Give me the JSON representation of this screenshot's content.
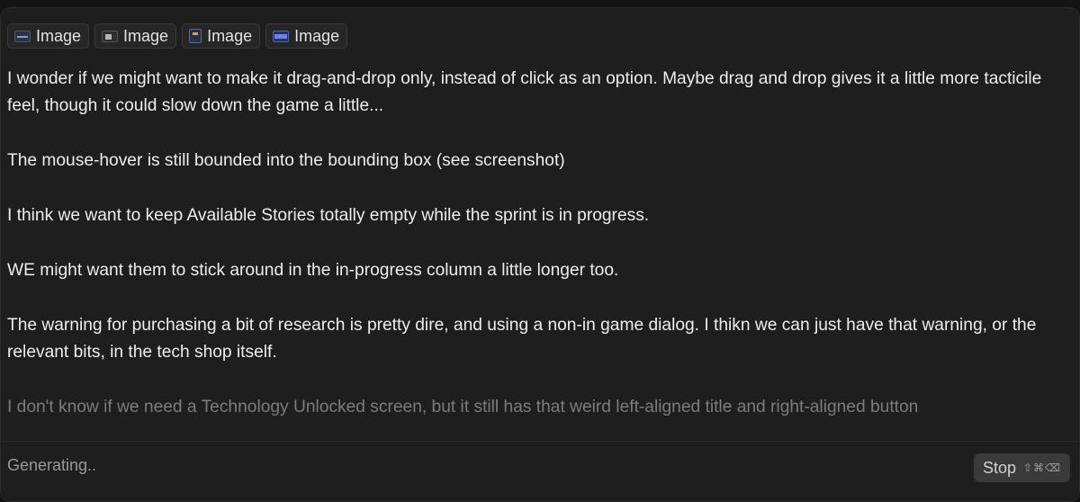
{
  "attachments": [
    {
      "label": "Image",
      "icon": "image-thumbnail-icon"
    },
    {
      "label": "Image",
      "icon": "image-thumbnail-icon"
    },
    {
      "label": "Image",
      "icon": "image-thumbnail-icon"
    },
    {
      "label": "Image",
      "icon": "image-thumbnail-icon"
    }
  ],
  "message": {
    "paragraphs": [
      "I wonder if we might want to make it drag-and-drop only, instead of click as an option. Maybe drag and drop gives it a little more tacticile feel, though it could slow down the game a little...",
      "The mouse-hover is still bounded into the bounding box (see screenshot)",
      "I think we want to keep Available Stories totally empty while the sprint is in progress.",
      "WE might want them to stick around in the in-progress column a little longer too.",
      "The warning for purchasing a bit of research is pretty dire, and using a non-in game dialog. I thikn we can just have that warning, or the relevant bits, in the tech shop itself.",
      "I don't know if we need a Technology Unlocked screen, but it still has that weird left-aligned title and right-aligned button"
    ]
  },
  "footer": {
    "status": "Generating..",
    "stop_label": "Stop",
    "stop_shortcut": "⇧⌘⌫"
  },
  "colors": {
    "background": "#1e1e1e",
    "text": "#ededed",
    "muted": "#9a9a9a",
    "button": "#3a3a3a"
  }
}
